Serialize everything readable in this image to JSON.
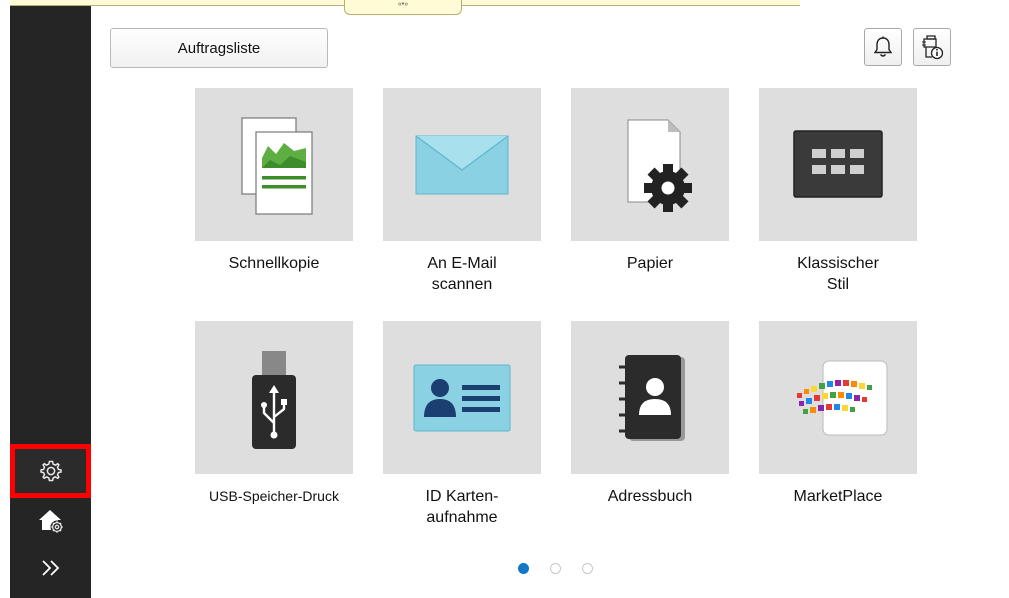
{
  "top_tab": {
    "label": "«•»"
  },
  "header": {
    "job_list_label": "Auftragsliste"
  },
  "sidebar": {
    "items": [
      {
        "name": "settings",
        "icon": "gear-icon"
      },
      {
        "name": "home-settings",
        "icon": "home-gear-icon"
      },
      {
        "name": "expand",
        "icon": "double-chevron-right-icon"
      }
    ]
  },
  "tiles": [
    {
      "label": "Schnellkopie",
      "icon": "copy-document-icon"
    },
    {
      "label": "An E-Mail\nscannen",
      "icon": "envelope-icon"
    },
    {
      "label": "Papier",
      "icon": "paper-gear-icon"
    },
    {
      "label": "Klassischer\nStil",
      "icon": "classic-grid-icon"
    },
    {
      "label": "USB-Speicher-Druck",
      "icon": "usb-icon"
    },
    {
      "label": "ID Karten-\naufnahme",
      "icon": "id-card-icon"
    },
    {
      "label": "Adressbuch",
      "icon": "address-book-icon"
    },
    {
      "label": "MarketPlace",
      "icon": "marketplace-icon"
    }
  ],
  "pager": {
    "pages": 3,
    "active": 1
  },
  "colors": {
    "accent": "#1278c8",
    "highlight": "#ff0000",
    "sidebar": "#252525",
    "tile": "#dedede"
  }
}
